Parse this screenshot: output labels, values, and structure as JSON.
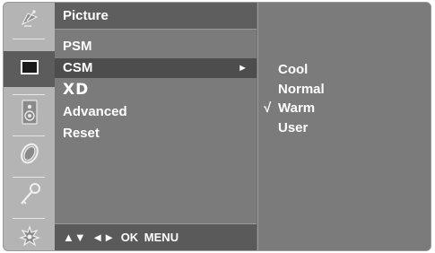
{
  "rail": {
    "icons": [
      "satellite-dish-icon",
      "picture-screen-icon",
      "speaker-icon",
      "clock-icon",
      "key-lock-icon",
      "option-gear-icon"
    ],
    "active_index": 1
  },
  "menu": {
    "title": "Picture",
    "items": [
      {
        "label": "PSM"
      },
      {
        "label": "CSM",
        "arrow": "►"
      },
      {
        "label": "XD"
      },
      {
        "label": "Advanced"
      },
      {
        "label": "Reset"
      }
    ],
    "selected_index": 1,
    "footer": "▲▼ ◄► OK MENU"
  },
  "submenu": {
    "items": [
      {
        "label": "Cool",
        "check": ""
      },
      {
        "label": "Normal",
        "check": ""
      },
      {
        "label": "Warm",
        "check": "√"
      },
      {
        "label": "User",
        "check": ""
      }
    ],
    "checked_index": 2
  },
  "colors": {
    "panel": "#7b7b7b",
    "header": "#5e5e5e",
    "rail": "#b4b4b4",
    "selected": "#4d4d4d",
    "text": "#ffffff"
  }
}
